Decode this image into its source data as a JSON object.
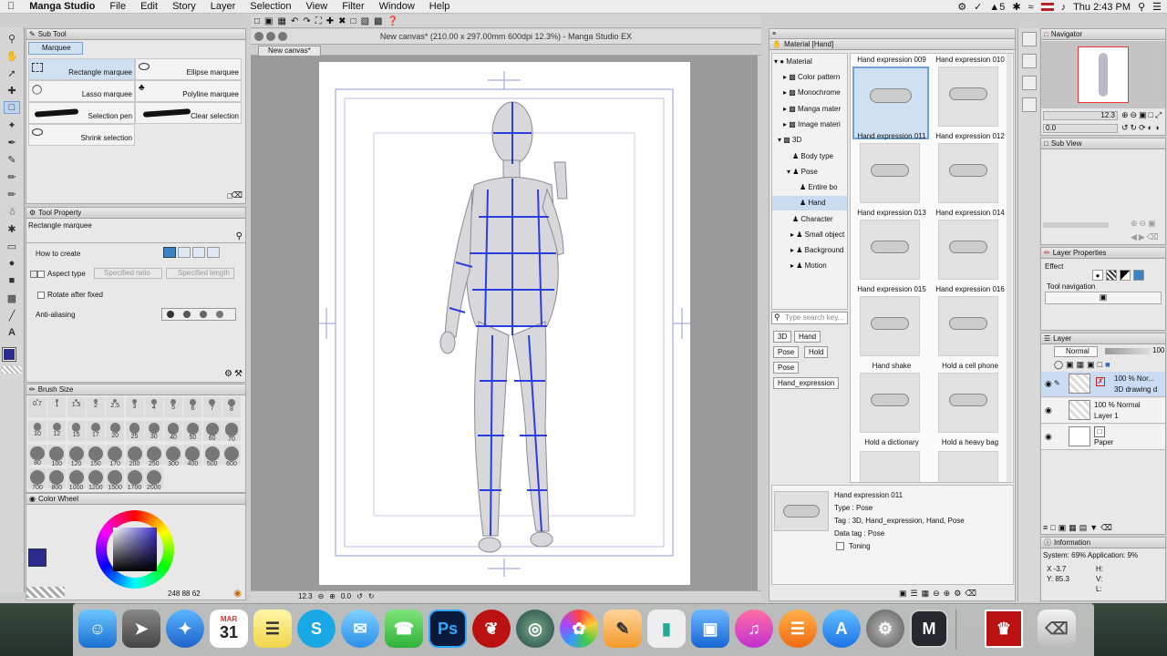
{
  "menubar": {
    "app": "Manga Studio",
    "items": [
      "File",
      "Edit",
      "Story",
      "Layer",
      "Selection",
      "View",
      "Filter",
      "Window",
      "Help"
    ],
    "battery": "5",
    "clock": "Thu 2:43 PM"
  },
  "document": {
    "title": "New canvas* (210.00 x 297.00mm 600dpi 12.3%)  - Manga Studio EX",
    "tab": "New canvas*"
  },
  "subtool": {
    "title": "Sub Tool",
    "tab": "Marquee",
    "items": [
      "Rectangle marquee",
      "Ellipse marquee",
      "Lasso marquee",
      "Polyline marquee",
      "Selection pen",
      "Clear selection",
      "Shrink selection"
    ]
  },
  "tool_property": {
    "title": "Tool Property",
    "tool_name": "Rectangle marquee",
    "rows": [
      "How to create",
      "Aspect type",
      "Rotate after fixed",
      "Anti-aliasing"
    ],
    "specified_ratio": "Specified ratio",
    "specified_length": "Specified length"
  },
  "brush_size": {
    "title": "Brush Size",
    "sizes": [
      "0.7",
      "1",
      "1.5",
      "2",
      "2.5",
      "3",
      "4",
      "5",
      "6",
      "7",
      "8",
      "10",
      "12",
      "15",
      "17",
      "20",
      "25",
      "30",
      "40",
      "50",
      "60",
      "70",
      "80",
      "100",
      "120",
      "150",
      "170",
      "200",
      "250",
      "300",
      "400",
      "500",
      "600",
      "700",
      "800",
      "1000",
      "1200",
      "1500",
      "1700",
      "2000"
    ]
  },
  "color_wheel": {
    "title": "Color Wheel",
    "values": "248  88  62",
    "main_color": "#2a2a8f"
  },
  "material": {
    "title": "Material [Hand]",
    "tree": [
      "Material",
      "Color pattern",
      "Monochrome",
      "Manga mater",
      "Image materi",
      "3D",
      "Body type",
      "Pose",
      "Entire bo",
      "Hand",
      "Character",
      "Small object",
      "Background",
      "Motion"
    ],
    "search_placeholder": "Type search key...",
    "tags": [
      "3D",
      "Hand",
      "Pose",
      "Hold",
      "Pose",
      "Hand_expression"
    ],
    "thumbnails": [
      "Hand expression 009",
      "Hand expression 010",
      "Hand expression 011",
      "Hand expression 012",
      "Hand expression 013",
      "Hand expression 014",
      "Hand expression 015",
      "Hand expression 016",
      "Hand shake",
      "Hold a cell phone",
      "Hold a dictionary",
      "Hold a heavy bag"
    ],
    "detail": {
      "name": "Hand expression 011",
      "type": "Type : Pose",
      "tag": "Tag : 3D, Hand_expression, Hand, Pose",
      "data_tag": "Data tag : Pose",
      "toning": "Toning"
    }
  },
  "navigator": {
    "title": "Navigator",
    "zoom": "12.3",
    "rotation": "0.0",
    "subview": "Sub View",
    "canvas_zoom": "12.3",
    "canvas_angle": "0.0"
  },
  "layer_properties": {
    "title": "Layer Properties",
    "effect": "Effect",
    "tool_navigation": "Tool navigation"
  },
  "layers": {
    "title": "Layer",
    "blend": "Normal",
    "opacity": "100",
    "items": [
      {
        "opacity": "100 % Nor...",
        "name": "3D drawing d"
      },
      {
        "opacity": "100 % Normal",
        "name": "Layer 1"
      },
      {
        "opacity": "",
        "name": "Paper"
      }
    ]
  },
  "information": {
    "title": "Information",
    "system": "System: 69% Application:  9%",
    "x": "X  -3.7",
    "y": "Y: 85.3",
    "h": "H:",
    "v": "V:",
    "l": "L:"
  },
  "dock": {
    "calendar_month": "MAR",
    "calendar_day": "31",
    "ps": "Ps",
    "m": "M"
  }
}
